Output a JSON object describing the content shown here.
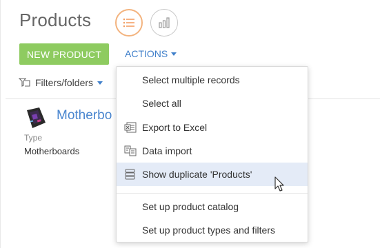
{
  "page": {
    "title": "Products"
  },
  "view_switch": {
    "list_icon": "list-icon",
    "analytics_icon": "bar-chart-icon"
  },
  "toolbar": {
    "new_product_label": "NEW PRODUCT",
    "actions_label": "ACTIONS"
  },
  "filters": {
    "label": "Filters/folders"
  },
  "record": {
    "name": "Motherbo",
    "type_label": "Type",
    "type_value": "Motherboards"
  },
  "actions_menu": {
    "items": [
      {
        "label": "Select multiple records",
        "icon": ""
      },
      {
        "label": "Select all",
        "icon": ""
      },
      {
        "label": "Export to Excel",
        "icon": "excel-export-icon"
      },
      {
        "label": "Data import",
        "icon": "data-import-icon"
      },
      {
        "label": "Show duplicate 'Products'",
        "icon": "duplicates-icon",
        "highlighted": true
      },
      {
        "label": "Set up product catalog",
        "icon": ""
      },
      {
        "label": "Set up product types and filters",
        "icon": ""
      }
    ]
  },
  "colors": {
    "new_product_bg": "#8ecb60",
    "link_blue": "#3f7fca",
    "list_icon_accent": "#f3a065",
    "menu_highlight": "#e4ebf7"
  }
}
